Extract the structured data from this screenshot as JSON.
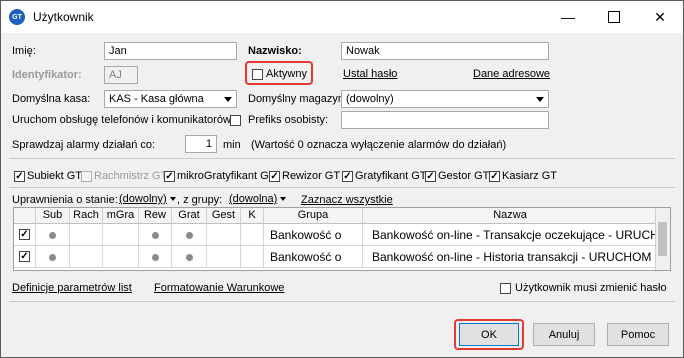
{
  "window": {
    "title": "Użytkownik",
    "app_icon": "GT"
  },
  "form": {
    "imie_label": "Imię:",
    "imie_value": "Jan",
    "nazwisko_label": "Nazwisko:",
    "nazwisko_value": "Nowak",
    "identyfikator_label": "Identyfikator:",
    "identyfikator_value": "AJ",
    "aktywny_label": "Aktywny",
    "ustal_haslo": "Ustal hasło",
    "dane_adresowe": "Dane adresowe",
    "kasa_label": "Domyślna kasa:",
    "kasa_value": "KAS - Kasa główna",
    "magazyn_label": "Domyślny magazyn:",
    "magazyn_value": "(dowolny)",
    "uruchom_label": "Uruchom obsługę telefonów i komunikatorów",
    "prefiks_label": "Prefiks osobisty:",
    "prefiks_value": "",
    "alarmy_label": "Sprawdzaj alarmy działań co:",
    "alarmy_value": "1",
    "alarmy_unit": "min",
    "alarmy_note": "(Wartość 0 oznacza wyłączenie alarmów do działań)"
  },
  "modules": [
    {
      "label": "Subiekt GT",
      "checked": true,
      "disabled": false
    },
    {
      "label": "Rachmistrz GT",
      "checked": false,
      "disabled": true
    },
    {
      "label": "mikroGratyfikant GT",
      "checked": true,
      "disabled": false
    },
    {
      "label": "Rewizor GT",
      "checked": true,
      "disabled": false
    },
    {
      "label": "Gratyfikant GT",
      "checked": true,
      "disabled": false
    },
    {
      "label": "Gestor GT",
      "checked": true,
      "disabled": false
    },
    {
      "label": "Kasiarz GT",
      "checked": true,
      "disabled": false
    }
  ],
  "filters": {
    "state_label": "Uprawnienia o stanie:",
    "state_value": "(dowolny)",
    "group_label": ", z grupy:",
    "group_value": "(dowolna)",
    "select_all": "Zaznacz wszystkie"
  },
  "table": {
    "columns": [
      "Sub",
      "Rach",
      "mGra",
      "Rew",
      "Grat",
      "Gest",
      "K",
      "Grupa",
      "Nazwa"
    ],
    "rows": [
      {
        "checked": true,
        "dots": [
          true,
          false,
          false,
          true,
          true,
          false,
          false
        ],
        "grupa": "Bankowość o",
        "nazwa": "Bankowość on-line - Transakcje oczekujące - URUCH"
      },
      {
        "checked": true,
        "dots": [
          true,
          false,
          false,
          true,
          true,
          false,
          false
        ],
        "grupa": "Bankowość o",
        "nazwa": "Bankowość on-line - Historia transakcji - URUCHOM"
      }
    ]
  },
  "footer": {
    "definicje": "Definicje parametrów list",
    "formatowanie": "Formatowanie Warunkowe",
    "musi_zmienic": "Użytkownik musi zmienić hasło"
  },
  "buttons": {
    "ok": "OK",
    "cancel": "Anuluj",
    "help": "Pomoc"
  },
  "colors": {
    "highlight": "#e53935",
    "app_icon": "#1f5fbf"
  }
}
